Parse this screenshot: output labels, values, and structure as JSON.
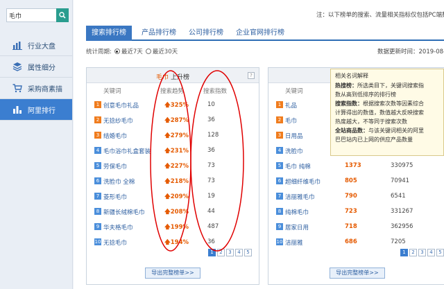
{
  "sidebar": {
    "search_value": "毛巾",
    "items": [
      {
        "label": "行业大盘",
        "icon": "bar-chart-icon"
      },
      {
        "label": "属性细分",
        "icon": "layers-icon"
      },
      {
        "label": "采购商素描",
        "icon": "cart-icon"
      },
      {
        "label": "阿里排行",
        "icon": "ranking-icon"
      }
    ]
  },
  "header": {
    "note": "注：以下榜单的搜索、流量相关指标仅包括PC端数据",
    "tabs": [
      "搜索排行榜",
      "产品排行榜",
      "公司排行榜",
      "企业官网排行榜"
    ],
    "period_label": "统计周期:",
    "period_options": [
      "最近7天",
      "最近30天"
    ],
    "update_label": "数据更新时间：2019-08-30"
  },
  "left_panel": {
    "title_highlight": "毛巾",
    "title_rest": "上升榜",
    "col_keyword": "关键词",
    "col_trend": "搜索趋势",
    "col_index": "搜索指数",
    "rows": [
      {
        "rank": "1",
        "kw": "创意毛巾礼品",
        "trend": "325%",
        "idx": "10"
      },
      {
        "rank": "2",
        "kw": "无捻纱毛巾",
        "trend": "287%",
        "idx": "36"
      },
      {
        "rank": "3",
        "kw": "结婚毛巾",
        "trend": "279%",
        "idx": "128"
      },
      {
        "rank": "4",
        "kw": "毛巾浴巾礼盒套装",
        "trend": "231%",
        "idx": "36"
      },
      {
        "rank": "5",
        "kw": "劳保毛巾",
        "trend": "227%",
        "idx": "73"
      },
      {
        "rank": "6",
        "kw": "洗脸巾 全棉",
        "trend": "218%",
        "idx": "73"
      },
      {
        "rank": "7",
        "kw": "菱形毛巾",
        "trend": "209%",
        "idx": "19"
      },
      {
        "rank": "8",
        "kw": "新疆长绒棉毛巾",
        "trend": "208%",
        "idx": "44"
      },
      {
        "rank": "9",
        "kw": "华夫格毛巾",
        "trend": "199%",
        "idx": "487"
      },
      {
        "rank": "10",
        "kw": "无捻毛巾",
        "trend": "194%",
        "idx": "36"
      }
    ],
    "pages": [
      "1",
      "2",
      "3",
      "4",
      "5"
    ],
    "export_label": "导出完整榜单>>"
  },
  "right_panel": {
    "col_keyword": "关键词",
    "rows": [
      {
        "rank": "1",
        "kw": "礼品",
        "v1": "",
        "v2": ""
      },
      {
        "rank": "2",
        "kw": "毛巾",
        "v1": "",
        "v2": ""
      },
      {
        "rank": "3",
        "kw": "日用品",
        "v1": "",
        "v2": ""
      },
      {
        "rank": "4",
        "kw": "洗脸巾",
        "v1": "",
        "v2": ""
      },
      {
        "rank": "5",
        "kw": "毛巾 纯棉",
        "v1": "1373",
        "v2": "330975"
      },
      {
        "rank": "6",
        "kw": "超细纤维毛巾",
        "v1": "805",
        "v2": "70941"
      },
      {
        "rank": "7",
        "kw": "洁丽雅毛巾",
        "v1": "790",
        "v2": "6541"
      },
      {
        "rank": "8",
        "kw": "纯棉毛巾",
        "v1": "723",
        "v2": "331267"
      },
      {
        "rank": "9",
        "kw": "居家日用",
        "v1": "718",
        "v2": "362956"
      },
      {
        "rank": "10",
        "kw": "洁丽雅",
        "v1": "686",
        "v2": "7205"
      }
    ],
    "pages": [
      "1",
      "2",
      "3",
      "4",
      "5"
    ],
    "export_label": "导出完整榜单>>"
  },
  "tooltip": {
    "title": "相关名词解释",
    "l1_b": "热搜榜：",
    "l1": "所选类目下，关键词搜索指",
    "l2": "数从高到低排序的排行榜",
    "l3_b": "搜索指数：",
    "l3": "根据搜索次数等因素综合",
    "l4": "计算得出的数值，数值越大反映搜索",
    "l5": "热度越大，不等同于搜索次数",
    "l6_b": "全站商品数：",
    "l6": "与该关键词相关的阿里",
    "l7": "巴巴站内已上网的供应产品数量"
  },
  "colors": {
    "accent": "#3b7ed0",
    "orange": "#e55a00",
    "annotation": "#e00000"
  }
}
